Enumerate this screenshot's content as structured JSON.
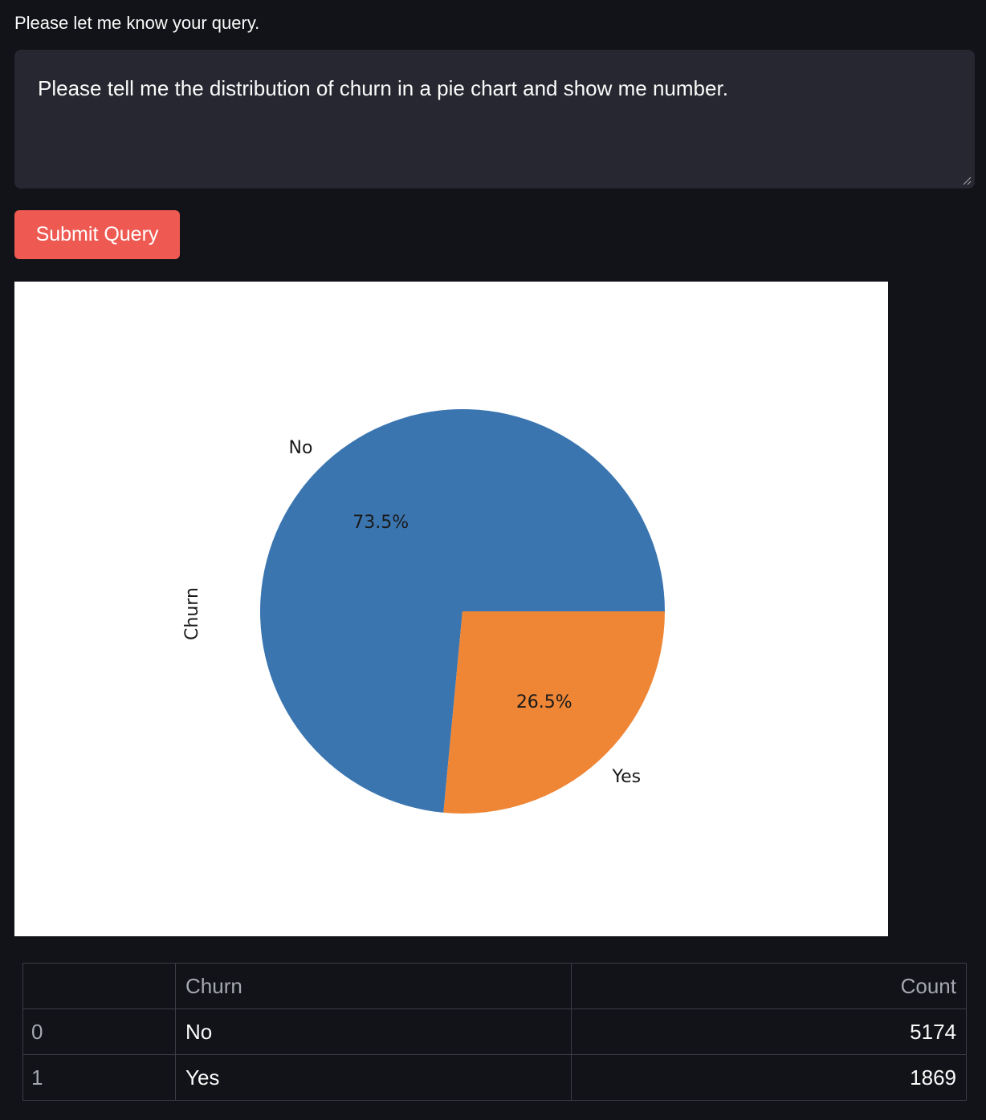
{
  "query": {
    "label": "Please let me know your query.",
    "value": "Please tell me the distribution of churn in a pie chart and show me number.",
    "submit_label": "Submit Query"
  },
  "chart_data": {
    "type": "pie",
    "ylabel": "Churn",
    "categories": [
      "No",
      "Yes"
    ],
    "values": [
      73.5,
      26.5
    ],
    "value_labels": [
      "73.5%",
      "26.5%"
    ],
    "colors": [
      "#3a75b0",
      "#ef8636"
    ]
  },
  "table": {
    "columns": [
      "",
      "Churn",
      "Count"
    ],
    "rows": [
      {
        "index": "0",
        "churn": "No",
        "count": "5174"
      },
      {
        "index": "1",
        "churn": "Yes",
        "count": "1869"
      }
    ]
  }
}
